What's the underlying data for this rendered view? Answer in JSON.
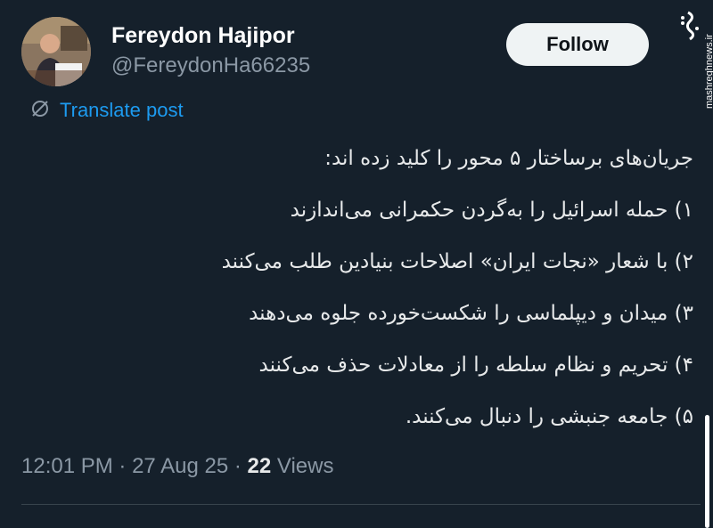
{
  "user": {
    "display_name": "Fereydon Hajipor",
    "handle": "@FereydonHa66235"
  },
  "follow_button": {
    "label": "Follow"
  },
  "translate": {
    "icon": "translate-icon",
    "label": "Translate post"
  },
  "tweet": {
    "lines": [
      "جریان‌های برساختار ۵ محور  را کلید زده اند:",
      "۱) حمله اسرائیل را به‌گردن حکمرانی می‌اندازند",
      "۲) با شعار «نجات ایران» اصلاحات بنیادین طلب می‌کنند",
      "۳) میدان و دیپلماسی را شکست‌خورده جلوه می‌دهند",
      "۴) تحریم و نظام سلطه را از معادلات حذف می‌کنند",
      "۵) جامعه جنبشی را دنبال می‌کنند."
    ]
  },
  "meta": {
    "time": "12:01 PM",
    "separator": " · ",
    "date": "27 Aug 25",
    "views_count": "22",
    "views_label": " Views"
  },
  "watermark": {
    "logo_text": "مشرق",
    "site": "mashreghnews.ir"
  },
  "colors": {
    "background": "#15202b",
    "text": "#e7e9ea",
    "muted": "#8b98a5",
    "accent": "#1d9bf0",
    "follow_bg": "#eff3f4"
  }
}
